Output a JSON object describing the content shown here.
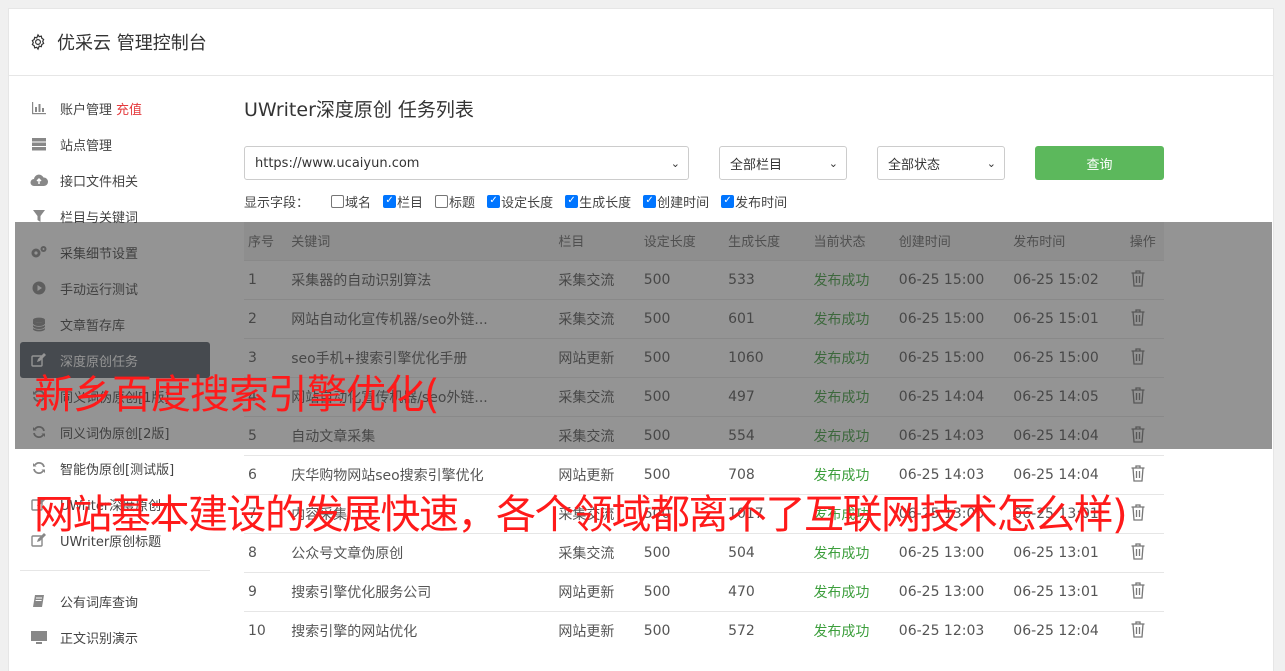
{
  "header": {
    "title": "优采云 管理控制台"
  },
  "sidebar": {
    "items": [
      {
        "label": "账户管理",
        "extra": "充值",
        "icon": "bar-chart-icon"
      },
      {
        "label": "站点管理",
        "icon": "server-icon"
      },
      {
        "label": "接口文件相关",
        "icon": "cloud-upload-icon"
      },
      {
        "label": "栏目与关键词",
        "icon": "filter-icon"
      },
      {
        "label": "采集细节设置",
        "icon": "gears-icon"
      },
      {
        "label": "手动运行测试",
        "icon": "play-icon"
      },
      {
        "label": "文章暂存库",
        "icon": "database-icon"
      },
      {
        "label": "深度原创任务",
        "icon": "edit-icon",
        "active": true
      },
      {
        "label": "同义词伪原创[1版]",
        "icon": "refresh-icon"
      },
      {
        "label": "同义词伪原创[2版]",
        "icon": "refresh-icon"
      },
      {
        "label": "智能伪原创[测试版]",
        "icon": "refresh-icon"
      },
      {
        "label": "UWriter深度原创",
        "icon": "edit-icon"
      },
      {
        "label": "UWriter原创标题",
        "icon": "edit-icon"
      },
      {
        "label": "公有词库查询",
        "icon": "book-icon"
      },
      {
        "label": "正文识别演示",
        "icon": "monitor-icon"
      }
    ]
  },
  "main": {
    "title": "UWriter深度原创 任务列表",
    "site_select": "https://www.ucaiyun.com",
    "column_select": "全部栏目",
    "status_select": "全部状态",
    "query_label": "查询",
    "fields_label": "显示字段：",
    "fields": [
      {
        "label": "域名",
        "checked": false
      },
      {
        "label": "栏目",
        "checked": true
      },
      {
        "label": "标题",
        "checked": false
      },
      {
        "label": "设定长度",
        "checked": true
      },
      {
        "label": "生成长度",
        "checked": true
      },
      {
        "label": "创建时间",
        "checked": true
      },
      {
        "label": "发布时间",
        "checked": true
      }
    ],
    "columns": [
      "序号",
      "关键词",
      "栏目",
      "设定长度",
      "生成长度",
      "当前状态",
      "创建时间",
      "发布时间",
      "操作"
    ],
    "rows": [
      [
        "1",
        "采集器的自动识别算法",
        "采集交流",
        "500",
        "533",
        "发布成功",
        "06-25 15:00",
        "06-25 15:02"
      ],
      [
        "2",
        "网站自动化宣传机器/seo外链...",
        "采集交流",
        "500",
        "601",
        "发布成功",
        "06-25 15:00",
        "06-25 15:01"
      ],
      [
        "3",
        "seo手机+搜索引擎优化手册",
        "网站更新",
        "500",
        "1060",
        "发布成功",
        "06-25 15:00",
        "06-25 15:00"
      ],
      [
        "4",
        "网站自动化宣传机器/seo外链...",
        "采集交流",
        "500",
        "497",
        "发布成功",
        "06-25 14:04",
        "06-25 14:05"
      ],
      [
        "5",
        "自动文章采集",
        "采集交流",
        "500",
        "554",
        "发布成功",
        "06-25 14:03",
        "06-25 14:04"
      ],
      [
        "6",
        "庆华购物网站seo搜索引擎优化",
        "网站更新",
        "500",
        "708",
        "发布成功",
        "06-25 14:03",
        "06-25 14:04"
      ],
      [
        "7",
        "内容采集",
        "采集交流",
        "500",
        "1017",
        "发布成功",
        "06-25 13:00",
        "06-25 13:01"
      ],
      [
        "8",
        "公众号文章伪原创",
        "采集交流",
        "500",
        "504",
        "发布成功",
        "06-25 13:00",
        "06-25 13:01"
      ],
      [
        "9",
        "搜索引擎优化服务公司",
        "网站更新",
        "500",
        "470",
        "发布成功",
        "06-25 13:00",
        "06-25 13:01"
      ],
      [
        "10",
        "搜索引擎的网站优化",
        "网站更新",
        "500",
        "572",
        "发布成功",
        "06-25 12:03",
        "06-25 12:04"
      ]
    ]
  },
  "overlay": {
    "line1": "新乡百度搜索引擎优化(",
    "line2": "网站基本建设的发展快速，各个领域都离不了互联网技术怎么样)"
  },
  "colors": {
    "accent": "#5cb85c",
    "active_nav": "#525b66",
    "recharge": "#e4393c",
    "overlay_text": "#ff1a1a"
  }
}
